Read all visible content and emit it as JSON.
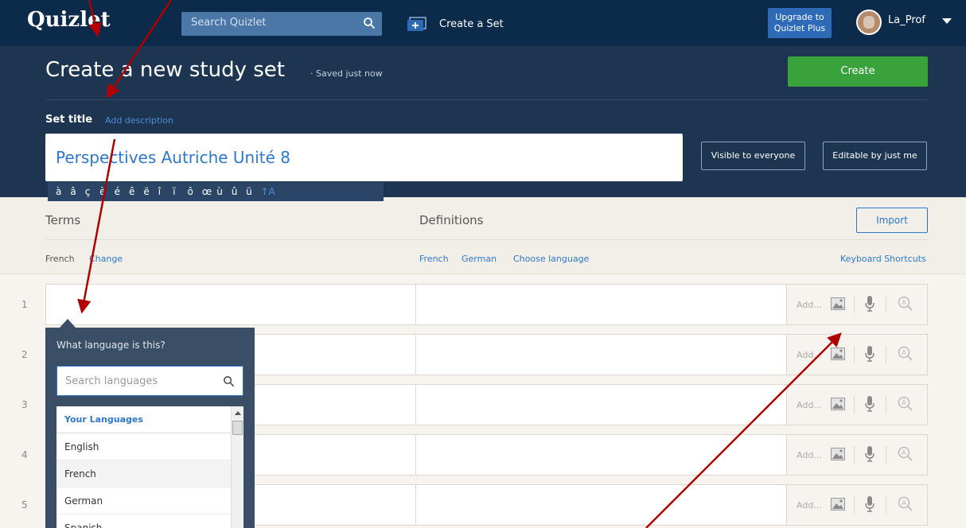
{
  "nav": {
    "logo": "Quizlet",
    "search_placeholder": "Search Quizlet",
    "create_set": "Create a Set",
    "upgrade": "Upgrade to Quizlet Plus",
    "username": "La_Prof"
  },
  "header": {
    "title": "Create a new study set",
    "saved": "· Saved just now",
    "create_button": "Create",
    "set_title_label": "Set title",
    "add_description": "Add description",
    "title_value": "Perspectives Autriche Unité 8",
    "visible_button": "Visible to everyone",
    "editable_button": "Editable by just me",
    "accents": [
      "à",
      "â",
      "ç",
      "è",
      "é",
      "ê",
      "ë",
      "î",
      "ï",
      "ô",
      "œ",
      "ù",
      "û",
      "ü"
    ],
    "shift_key": "↑A"
  },
  "columns": {
    "terms": "Terms",
    "definitions": "Definitions",
    "import": "Import",
    "term_language": "French",
    "change": "Change",
    "def_languages": [
      "French",
      "German",
      "Choose language"
    ],
    "keyboard_shortcuts": "Keyboard Shortcuts"
  },
  "rows": [
    {
      "num": "1",
      "add": "Add..."
    },
    {
      "num": "2",
      "add": "Add..."
    },
    {
      "num": "3",
      "add": "Add..."
    },
    {
      "num": "4",
      "add": "Add..."
    },
    {
      "num": "5",
      "add": "Add..."
    }
  ],
  "language_popup": {
    "question": "What language is this?",
    "search_placeholder": "Search languages",
    "section": "Your Languages",
    "options": [
      "English",
      "French",
      "German",
      "Spanish"
    ],
    "selected": "French"
  },
  "colors": {
    "nav_bg": "#0c2a4a",
    "header_bg": "#1d3550",
    "create_green": "#3aa23a",
    "link_blue": "#2d77d0",
    "arrow_red": "#b00000"
  },
  "icons": [
    "search-icon",
    "create-set-icon",
    "caret-down-icon",
    "image-icon",
    "microphone-icon",
    "auto-define-icon"
  ]
}
